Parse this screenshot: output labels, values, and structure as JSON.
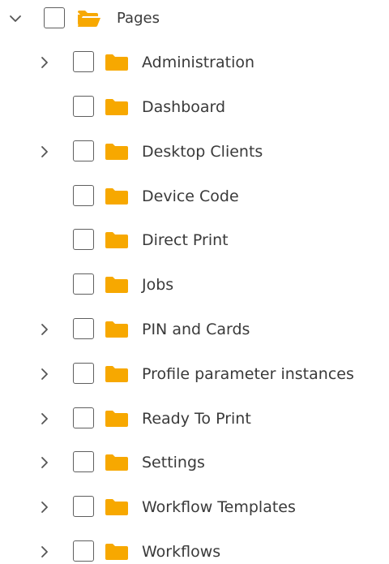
{
  "colors": {
    "folder": "#F7A800",
    "text": "#3a3a3a",
    "checkbox_border": "#5f5f5f",
    "chevron": "#555555"
  },
  "root": {
    "label": "Pages",
    "expanded": true,
    "icon": "folder-open-icon"
  },
  "children": [
    {
      "label": "Administration",
      "has_children": true
    },
    {
      "label": "Dashboard",
      "has_children": false
    },
    {
      "label": "Desktop Clients",
      "has_children": true
    },
    {
      "label": "Device Code",
      "has_children": false
    },
    {
      "label": "Direct Print",
      "has_children": false
    },
    {
      "label": "Jobs",
      "has_children": false
    },
    {
      "label": "PIN and Cards",
      "has_children": true
    },
    {
      "label": "Profile parameter instances",
      "has_children": true
    },
    {
      "label": "Ready To Print",
      "has_children": true
    },
    {
      "label": "Settings",
      "has_children": true
    },
    {
      "label": "Workflow Templates",
      "has_children": true
    },
    {
      "label": "Workflows",
      "has_children": true
    }
  ]
}
